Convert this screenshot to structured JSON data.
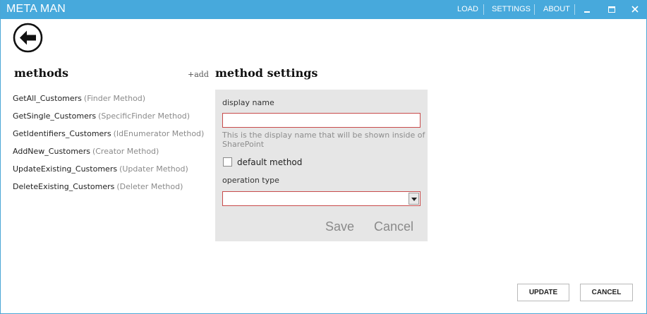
{
  "app": {
    "title": "META MAN"
  },
  "titlebar": {
    "links": [
      "LOAD",
      "SETTINGS",
      "ABOUT"
    ],
    "controls": [
      "minimize-icon",
      "maximize-icon",
      "close-icon"
    ]
  },
  "back": {
    "icon": "arrow-left-icon"
  },
  "methods": {
    "heading": "methods",
    "add_label": "+add",
    "items": [
      {
        "name": "GetAll_Customers",
        "type": "(Finder Method)"
      },
      {
        "name": "GetSingle_Customers",
        "type": "(SpecificFinder Method)"
      },
      {
        "name": "GetIdentifiers_Customers",
        "type": "(IdEnumerator Method)"
      },
      {
        "name": "AddNew_Customers",
        "type": "(Creator Method)"
      },
      {
        "name": "UpdateExisting_Customers",
        "type": "(Updater Method)"
      },
      {
        "name": "DeleteExisting_Customers",
        "type": "(Deleter Method)"
      }
    ]
  },
  "settings": {
    "heading": "method settings",
    "display_name_label": "display name",
    "display_name_value": "",
    "display_name_help": "This is the display name that will be shown inside of SharePoint",
    "default_method_label": "default method",
    "default_method_checked": false,
    "operation_type_label": "operation type",
    "operation_type_value": "",
    "save_label": "Save",
    "cancel_label": "Cancel"
  },
  "footer": {
    "update_label": "UPDATE",
    "cancel_label": "CANCEL"
  },
  "colors": {
    "titlebar": "#47a9dc",
    "panel": "#e6e6e6",
    "invalid_border": "#c84b4b"
  }
}
